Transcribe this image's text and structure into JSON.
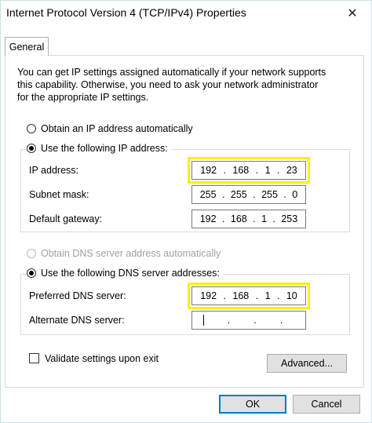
{
  "window": {
    "title": "Internet Protocol Version 4 (TCP/IPv4) Properties",
    "close_glyph": "✕"
  },
  "tabs": [
    {
      "label": "General"
    }
  ],
  "description": "You can get IP settings assigned automatically if your network supports\nthis capability. Otherwise, you need to ask your network administrator\nfor the appropriate IP settings.",
  "ip": {
    "auto_label": "Obtain an IP address automatically",
    "manual_label": "Use the following IP address:",
    "ip_label": "IP address:",
    "ip_value": [
      "192",
      "168",
      "1",
      "23"
    ],
    "mask_label": "Subnet mask:",
    "mask_value": [
      "255",
      "255",
      "255",
      "0"
    ],
    "gateway_label": "Default gateway:",
    "gateway_value": [
      "192",
      "168",
      "1",
      "253"
    ]
  },
  "dns": {
    "auto_label": "Obtain DNS server address automatically",
    "manual_label": "Use the following DNS server addresses:",
    "preferred_label": "Preferred DNS server:",
    "preferred_value": [
      "192",
      "168",
      "1",
      "10"
    ],
    "alternate_label": "Alternate DNS server:",
    "alternate_value": [
      "",
      "",
      "",
      ""
    ]
  },
  "validate_label": "Validate settings upon exit",
  "buttons": {
    "advanced": "Advanced...",
    "ok": "OK",
    "cancel": "Cancel"
  },
  "highlight_color": "#ffef00"
}
